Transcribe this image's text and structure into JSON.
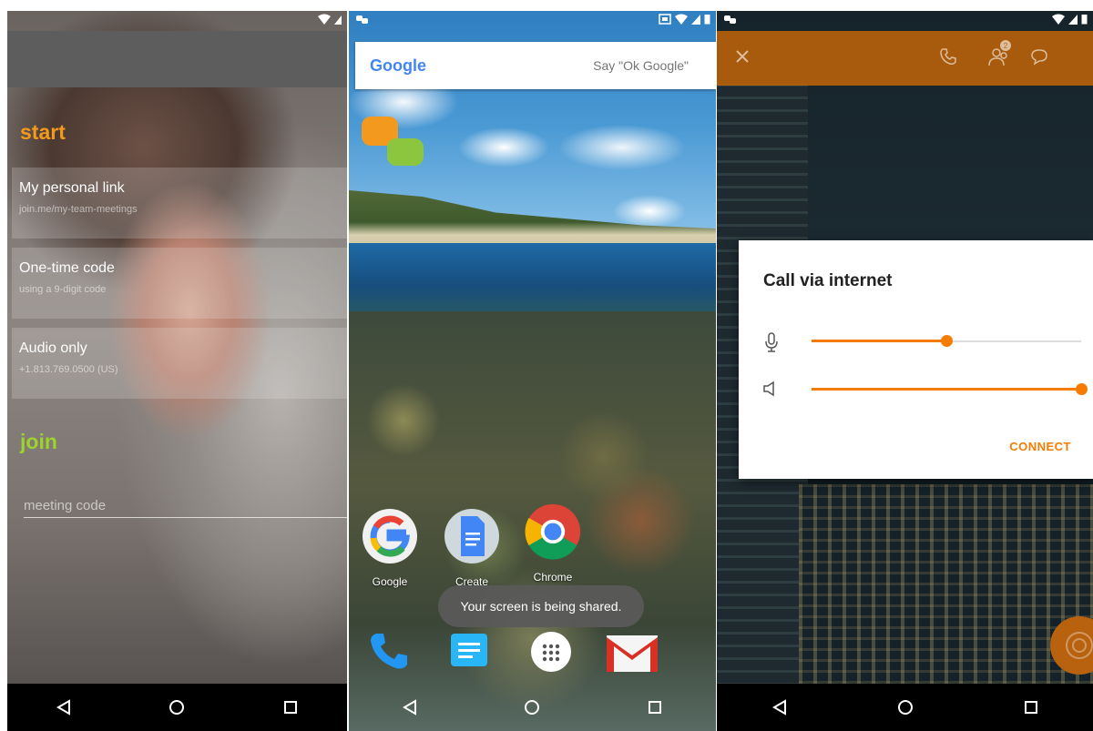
{
  "colors": {
    "orange": "#f57c00",
    "start": "#f39a1e",
    "join": "#9dd32a",
    "toolbar": "#b8620f"
  },
  "screen1": {
    "start_title": "start",
    "join_title": "join",
    "options": [
      {
        "title": "My personal link",
        "subtitle": "join.me/my-team-meetings"
      },
      {
        "title": "One-time code",
        "subtitle": "using a 9-digit code"
      },
      {
        "title": "Audio only",
        "subtitle": "+1.813.769.0500 (US)"
      }
    ],
    "meeting_code_placeholder": "meeting code"
  },
  "screen2": {
    "search_logo": "Google",
    "search_hint": "Say \"Ok Google\"",
    "apps": [
      "Google",
      "Create",
      "Chrome"
    ],
    "toast": "Your screen is being shared."
  },
  "screen3": {
    "dialog_title": "Call via internet",
    "mic_level": 0.5,
    "speaker_level": 1.0,
    "connect_label": "CONNECT",
    "participants_badge": "2"
  }
}
